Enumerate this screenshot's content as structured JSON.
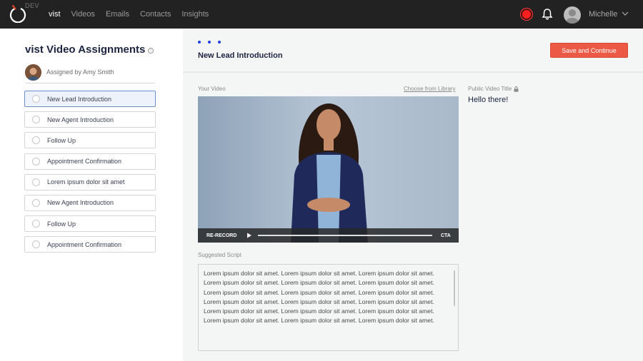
{
  "topbar": {
    "env": "DEV",
    "nav": [
      {
        "label": "vist",
        "active": true
      },
      {
        "label": "Videos",
        "active": false
      },
      {
        "label": "Emails",
        "active": false
      },
      {
        "label": "Contacts",
        "active": false
      },
      {
        "label": "Insights",
        "active": false
      }
    ],
    "user_name": "Michelle",
    "icons": [
      "logo-icon",
      "record-icon",
      "bell-icon",
      "user-avatar",
      "chevron-down-icon"
    ],
    "record_color": "#ff1f1f"
  },
  "sidebar": {
    "title": "vist Video Assignments",
    "info_icon": "info-icon",
    "assigned_by": "Assigned by Amy Smith",
    "items": [
      {
        "label": "New Lead Introduction",
        "active": true
      },
      {
        "label": "New Agent Introduction",
        "active": false
      },
      {
        "label": "Follow Up",
        "active": false
      },
      {
        "label": "Appointment Confirmation",
        "active": false
      },
      {
        "label": "Lorem ipsum dolor sit amet",
        "active": false
      },
      {
        "label": "New Agent Introduction",
        "active": false
      },
      {
        "label": "Follow Up",
        "active": false
      },
      {
        "label": "Appointment Confirmation",
        "active": false
      }
    ]
  },
  "main": {
    "title": "New Lead Introduction",
    "save_label": "Save and Continue",
    "accent": "#ec5a45",
    "your_video_label": "Your Video",
    "choose_library": "Choose from Library",
    "public_title_label": "Public Video Title",
    "public_title": "Hello there!",
    "video": {
      "rerecord": "RE-RECORD",
      "cta": "CTA"
    },
    "script_label": "Suggested Script",
    "script_text": "Lorem ipsum dolor sit amet. Lorem ipsum dolor sit amet. Lorem ipsum dolor sit amet. Lorem ipsum dolor sit amet. Lorem ipsum dolor sit amet. Lorem ipsum dolor sit amet. Lorem ipsum dolor sit amet. Lorem ipsum dolor sit amet. Lorem ipsum dolor sit amet. Lorem ipsum dolor sit amet. Lorem ipsum dolor sit amet. Lorem ipsum dolor sit amet. Lorem ipsum dolor sit amet. Lorem ipsum dolor sit amet. Lorem ipsum dolor sit amet. Lorem ipsum dolor sit amet. Lorem ipsum dolor sit amet. Lorem ipsum dolor sit amet."
  }
}
